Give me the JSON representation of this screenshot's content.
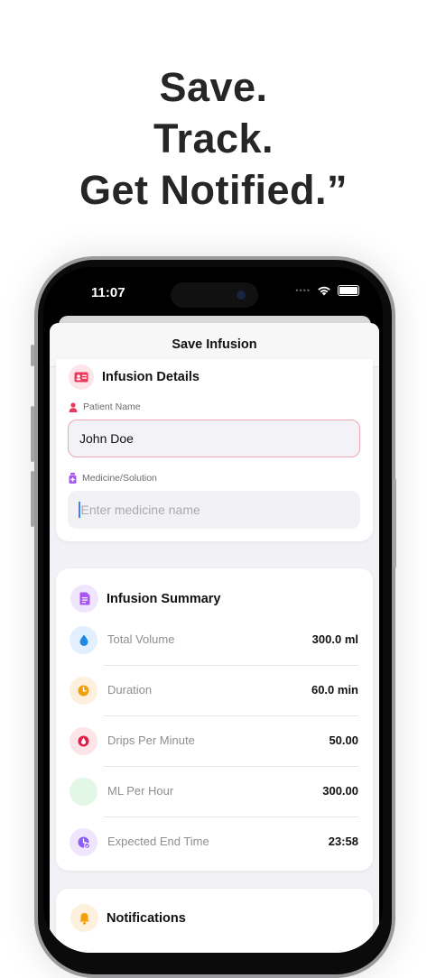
{
  "headline": [
    "Save.",
    "Track.",
    "Get Notified.”"
  ],
  "status_bar": {
    "time": "11:07",
    "signal_dots": "••••"
  },
  "nav": {
    "title": "Save Infusion"
  },
  "infusion_details": {
    "title": "Infusion Details",
    "patient_label": "Patient Name",
    "patient_value": "John Doe",
    "medicine_label": "Medicine/Solution",
    "medicine_placeholder": "Enter medicine name"
  },
  "summary": {
    "title": "Infusion Summary",
    "rows": [
      {
        "label": "Total Volume",
        "value": "300.0 ml",
        "icon": "drop-icon",
        "color": "#1e88e5",
        "bg": "#e1efff"
      },
      {
        "label": "Duration",
        "value": "60.0 min",
        "icon": "clock-icon",
        "color": "#f59e0b",
        "bg": "#fdf0dc"
      },
      {
        "label": "Drips Per Minute",
        "value": "50.00",
        "icon": "blood-drop-icon",
        "color": "#e11d48",
        "bg": "#fde4e8"
      },
      {
        "label": "ML Per Hour",
        "value": "300.00",
        "icon": "speed-icon",
        "color": "#22c55e",
        "bg": "#e3f7e6"
      },
      {
        "label": "Expected End Time",
        "value": "23:58",
        "icon": "clock-check-icon",
        "color": "#8b5cf6",
        "bg": "#efe6fd"
      }
    ]
  },
  "notifications": {
    "title": "Notifications"
  },
  "colors": {
    "accent_pink": "#ea3a5c",
    "accent_purple": "#a855f7",
    "accent_orange": "#f59e0b"
  }
}
